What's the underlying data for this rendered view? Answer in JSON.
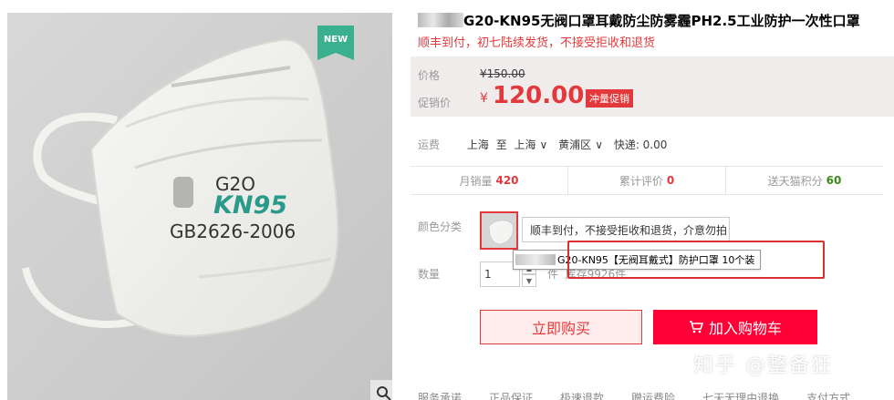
{
  "gallery": {
    "badge": "NEW",
    "mask_print": {
      "brand": "G2O",
      "model": "KN95",
      "standard": "GB2626-2006"
    },
    "zoom_icon": "magnifier-icon"
  },
  "product": {
    "title": "G20-KN95无阀口罩耳戴防尘防雾霾PH2.5工业防护一次性口罩",
    "subtitle": "顺丰到付，初七陆续发货，不接受拒收和退货"
  },
  "price": {
    "orig_label": "价格",
    "orig_value": "¥150.00",
    "sale_label": "促销价",
    "yen": "¥",
    "sale_value": "120.00",
    "promo_tag": "冲量促销"
  },
  "shipping": {
    "label": "运费",
    "from": "上海",
    "to_word": "至",
    "to": "上海",
    "district": "黄浦区",
    "express": "快递: 0.00"
  },
  "stats": [
    {
      "label": "月销量",
      "value": "420",
      "color": "#e4393c"
    },
    {
      "label": "累计评价",
      "value": "0",
      "color": "#e4393c"
    },
    {
      "label": "送天猫积分",
      "value": "60",
      "color": "#3a8a17"
    }
  ],
  "sku": {
    "label": "颜色分类",
    "tip": "顺丰到付，不接受拒收和退货，介意勿拍",
    "variant_popup": "G20-KN95【无阀耳戴式】防护口罩 10个装"
  },
  "quantity": {
    "label": "数量",
    "value": "1",
    "unit": "件",
    "stock": "库存9926件"
  },
  "actions": {
    "buy_now": "立即购买",
    "add_cart": "加入购物车"
  },
  "watermark": "知乎 @整备狂",
  "bottom_links": [
    "服务承诺",
    "正品保证",
    "极速退款",
    "赠运费险",
    "七天无理由退换",
    "支付方式"
  ],
  "colors": {
    "accent": "#e4393c",
    "cart": "#ff0036",
    "badge": "#3bb08f"
  }
}
